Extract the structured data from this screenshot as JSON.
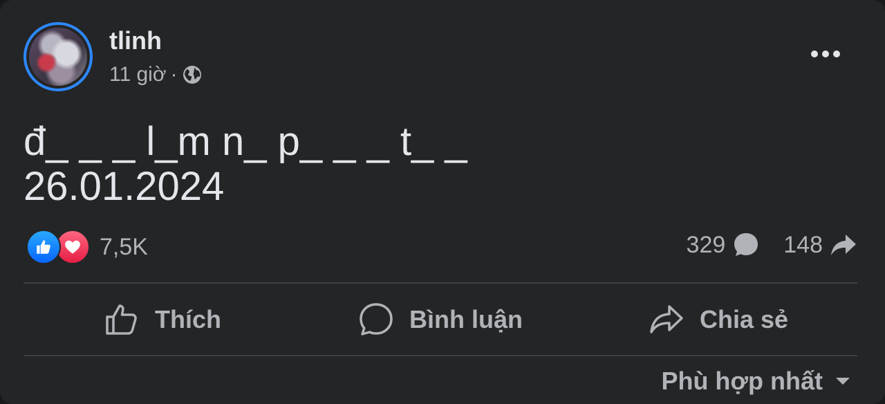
{
  "post": {
    "author": "tlinh",
    "time": "11 giờ",
    "separator": "·",
    "privacy_icon": "globe-icon",
    "text": "đ_ _ _ l_m n_ p_ _ _ t_ _\n26.01.2024"
  },
  "reactions": {
    "icons": [
      "like-icon",
      "love-icon"
    ],
    "count": "7,5K"
  },
  "stats": {
    "comments": "329",
    "shares": "148"
  },
  "actions": {
    "like": "Thích",
    "comment": "Bình luận",
    "share": "Chia sẻ"
  },
  "sort": {
    "label": "Phù hợp nhất"
  },
  "colors": {
    "background": "#242526",
    "text_primary": "#e4e6eb",
    "text_secondary": "#b0b3b8",
    "like_blue": "#0866ff",
    "love_red": "#e61e44",
    "avatar_ring": "#2d88ff"
  }
}
